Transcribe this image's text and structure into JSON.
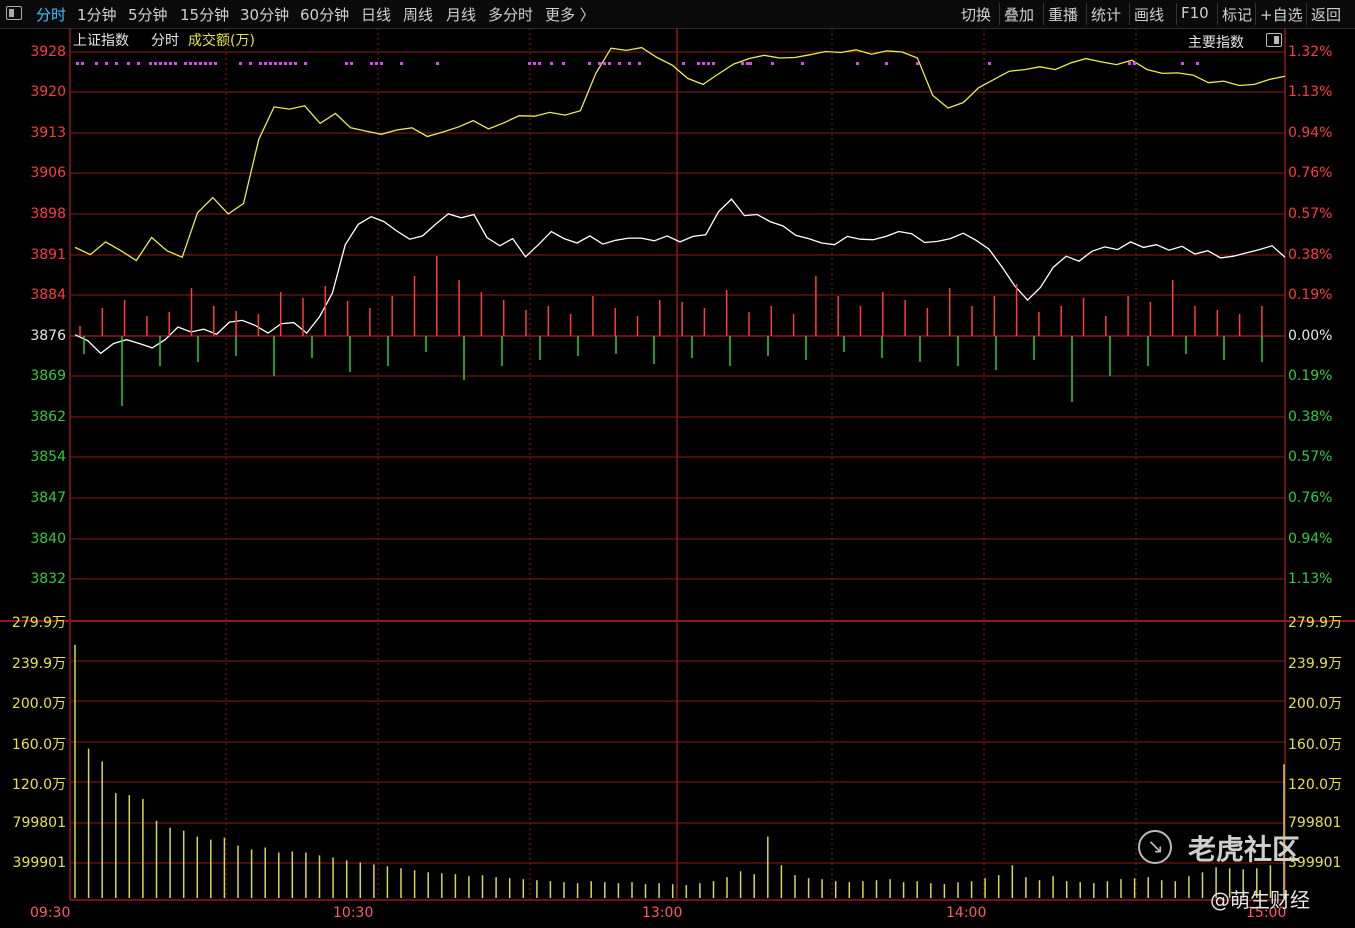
{
  "toolbar": {
    "tabs": [
      "分时",
      "1分钟",
      "5分钟",
      "15分钟",
      "30分钟",
      "60分钟",
      "日线",
      "周线",
      "月线",
      "多分时",
      "更多 〉"
    ],
    "active_tab": "分时",
    "right_tabs": [
      "切换",
      "叠加",
      "重播",
      "统计",
      "画线",
      "F10",
      "标记",
      "+自选",
      "返回"
    ]
  },
  "header": {
    "index_name": "上证指数",
    "mode": "分时",
    "volume_label": "成交额(万)",
    "main_index_label": "主要指数"
  },
  "price_axis": {
    "left": [
      "3928",
      "3920",
      "3913",
      "3906",
      "3898",
      "3891",
      "3884",
      "3876",
      "3869",
      "3862",
      "3854",
      "3847",
      "3840",
      "3832"
    ],
    "right": [
      "1.32%",
      "1.13%",
      "0.94%",
      "0.76%",
      "0.57%",
      "0.38%",
      "0.19%",
      "0.00%",
      "0.19%",
      "0.38%",
      "0.57%",
      "0.76%",
      "0.94%",
      "1.13%"
    ],
    "colors": [
      "red",
      "red",
      "red",
      "red",
      "red",
      "red",
      "red",
      "white",
      "green",
      "green",
      "green",
      "green",
      "green",
      "green"
    ]
  },
  "volume_axis": {
    "left": [
      "279.9万",
      "239.9万",
      "200.0万",
      "160.0万",
      "120.0万",
      "799801",
      "399901"
    ],
    "right": [
      "279.9万",
      "239.9万",
      "200.0万",
      "160.0万",
      "120.0万",
      "799801",
      "399901"
    ]
  },
  "time_axis": [
    "09:30",
    "10:30",
    "13:00",
    "14:00",
    "15:00"
  ],
  "watermark": {
    "brand": "老虎社区",
    "user": "@萌生财经"
  },
  "colors": {
    "background": "#000000",
    "grid": "#8b1a1a",
    "up": "#ff3b3b",
    "down": "#2ecc40",
    "price_line": "#ffffff",
    "avg_line": "#ecec4a",
    "volume": "#d8d84a",
    "marker": "#d946ef",
    "active_tab": "#39c6ff"
  },
  "chart_data": {
    "type": "line",
    "series": [
      {
        "values": [
          3876.5,
          3875.4,
          3873.1,
          3874.9,
          3875.6,
          3874.9,
          3874.1,
          3875.6,
          3877.9,
          3877.0,
          3877.5,
          3876.6,
          3878.8,
          3879.1,
          3878.2,
          3876.8,
          3878.5,
          3878.7,
          3876.8,
          3879.8,
          3884.1,
          3892.9,
          3896.6,
          3898.0,
          3897.1,
          3895.4,
          3893.9,
          3894.5,
          3896.6,
          3898.5,
          3897.8,
          3898.4,
          3894.2,
          3892.7,
          3894.0,
          3890.7,
          3892.9,
          3895.3,
          3894.0,
          3893.2,
          3894.5,
          3893.0,
          3893.7,
          3894.1,
          3894.1,
          3893.6,
          3894.5,
          3893.4,
          3894.4,
          3894.7,
          3898.9,
          3901.2,
          3898.2,
          3898.4,
          3897.1,
          3896.3,
          3894.6,
          3894.0,
          3893.2,
          3892.9,
          3894.4,
          3893.9,
          3893.8,
          3894.4,
          3895.3,
          3894.9,
          3893.3,
          3893.5,
          3894.0,
          3895.0,
          3893.7,
          3892.1,
          3888.9,
          3885.4,
          3882.8,
          3885.1,
          3888.8,
          3890.8,
          3889.9,
          3891.7,
          3892.5,
          3892.0,
          3893.4,
          3892.4,
          3892.9,
          3891.9,
          3892.6,
          3891.2,
          3891.8,
          3890.5,
          3890.8,
          3891.4,
          3892.0,
          3892.7,
          3890.6
        ]
      },
      {
        "values": [
          3892.4,
          3891.1,
          3893.4,
          3891.8,
          3890.0,
          3894.2,
          3891.8,
          3890.6,
          3898.7,
          3901.5,
          3898.5,
          3900.4,
          3912.1,
          3918.0,
          3917.6,
          3918.2,
          3915.0,
          3916.8,
          3914.2,
          3913.6,
          3913.0,
          3913.8,
          3914.2,
          3912.6,
          3913.4,
          3914.3,
          3915.5,
          3914.0,
          3915.1,
          3916.4,
          3916.3,
          3917.0,
          3916.5,
          3917.3,
          3924.1,
          3928.7,
          3928.3,
          3928.8,
          3927.0,
          3925.6,
          3923.2,
          3922.1,
          3924.0,
          3925.8,
          3926.8,
          3927.4,
          3926.9,
          3927.0,
          3927.5,
          3928.1,
          3927.9,
          3928.4,
          3927.6,
          3928.2,
          3928.0,
          3926.9,
          3920.1,
          3917.8,
          3918.8,
          3921.5,
          3923.0,
          3924.5,
          3924.8,
          3925.3,
          3924.8,
          3926.0,
          3926.8,
          3926.2,
          3925.7,
          3926.5,
          3924.8,
          3924.1,
          3924.2,
          3923.8,
          3922.4,
          3922.7,
          3921.9,
          3922.1,
          3923.0,
          3923.6
        ]
      }
    ],
    "ylim": [
      3832,
      3928
    ],
    "volume_series": [
      2560000,
      1510000,
      1380000,
      1060000,
      1040000,
      1000000,
      780000,
      710000,
      680000,
      620000,
      590000,
      610000,
      530000,
      490000,
      510000,
      460000,
      470000,
      460000,
      430000,
      410000,
      380000,
      360000,
      340000,
      320000,
      300000,
      280000,
      260000,
      250000,
      240000,
      220000,
      230000,
      210000,
      200000,
      190000,
      180000,
      170000,
      160000,
      150000,
      170000,
      160000,
      150000,
      160000,
      140000,
      150000,
      140000,
      130000,
      150000,
      170000,
      210000,
      270000,
      240000,
      620000,
      330000,
      230000,
      200000,
      190000,
      170000,
      160000,
      170000,
      180000,
      190000,
      160000,
      170000,
      150000,
      140000,
      160000,
      170000,
      200000,
      230000,
      330000,
      210000,
      180000,
      220000,
      170000,
      160000,
      150000,
      170000,
      190000,
      200000,
      210000,
      180000,
      170000,
      220000,
      260000,
      310000,
      300000,
      290000,
      300000,
      330000,
      1350000
    ],
    "volume_ylim": [
      0,
      2799000
    ]
  }
}
